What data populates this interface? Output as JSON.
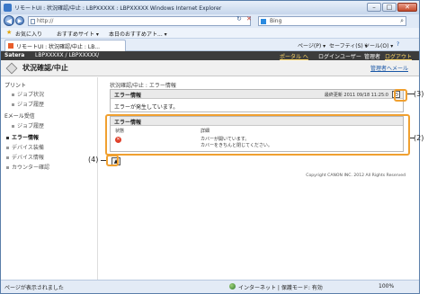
{
  "window": {
    "title": "リモートUI : 状況確認/中止 : LBPXXXXX : LBPXXXXX Windows Internet Explorer",
    "min": "–",
    "max": "□",
    "close": "✕"
  },
  "address_bar": {
    "back": "◀",
    "forward": "▶",
    "url": "http://",
    "refresh_icon": "↻",
    "stop_icon": "✕",
    "search_engine": "Bing",
    "search_icon": "⌕"
  },
  "favorites_bar": {
    "favorites": "お気に入り",
    "suggested": "おすすめサイト ▾",
    "today": "本日のおすすめアト... ▾"
  },
  "tab": {
    "label": "リモートUI : 状況確認/中止 : LB...",
    "commands": {
      "page": "ページ(P) ▾",
      "safety": "セーフティ(S) ▾",
      "tools": "ツール(O) ▾",
      "help": "?"
    }
  },
  "brand_bar": {
    "brand": "Satera",
    "model": "LBPXXXXX / LBPXXXXX/",
    "portal": "ポータル へ",
    "login_user": "ログインユーザー",
    "admin": "管理者",
    "logout": "ログアウト"
  },
  "header": {
    "title": "状況確認/中止",
    "mail_link": "管理者へメール"
  },
  "sidebar": {
    "sections": [
      {
        "label": "プリント",
        "items": [
          "ジョブ状況",
          "ジョブ履歴"
        ]
      },
      {
        "label": "Eメール受信",
        "items": [
          "ジョブ履歴"
        ]
      }
    ],
    "nav": [
      {
        "label": "エラー情報",
        "active": true
      },
      {
        "label": "デバイス装備",
        "active": false
      },
      {
        "label": "デバイス情報",
        "active": false
      },
      {
        "label": "カウンター確認",
        "active": false
      }
    ]
  },
  "main": {
    "breadcrumb": "状況確認/中止 : エラー情報",
    "error_info_panel": {
      "title": "エラー情報",
      "last_updated": "最終更新 2011 09/18 11:25:0",
      "refresh_icon": "⟲",
      "message": "エラーが発生しています。"
    },
    "error_detail_panel": {
      "title": "エラー情報",
      "col_status": "状態",
      "col_detail": "詳細",
      "status_icon": "✕",
      "detail_line1": "カバーが開いています。",
      "detail_line2": "カバーをきちんと閉じてください。"
    },
    "back_icon": "▲",
    "copyright": "Copyright CANON INC. 2012 All Rights Reserved"
  },
  "status_bar": {
    "left": "ページが表示されました",
    "zone": "インターネット | 保護モード: 有効",
    "zoom": "100%"
  },
  "callouts": {
    "c3": "(3)",
    "c2": "(2)",
    "c4": "(4)"
  },
  "colors": {
    "highlight": "#f0a030",
    "brand_bar": "#3c3c3c",
    "link": "#1a57a6",
    "error_icon": "#e0402a"
  }
}
